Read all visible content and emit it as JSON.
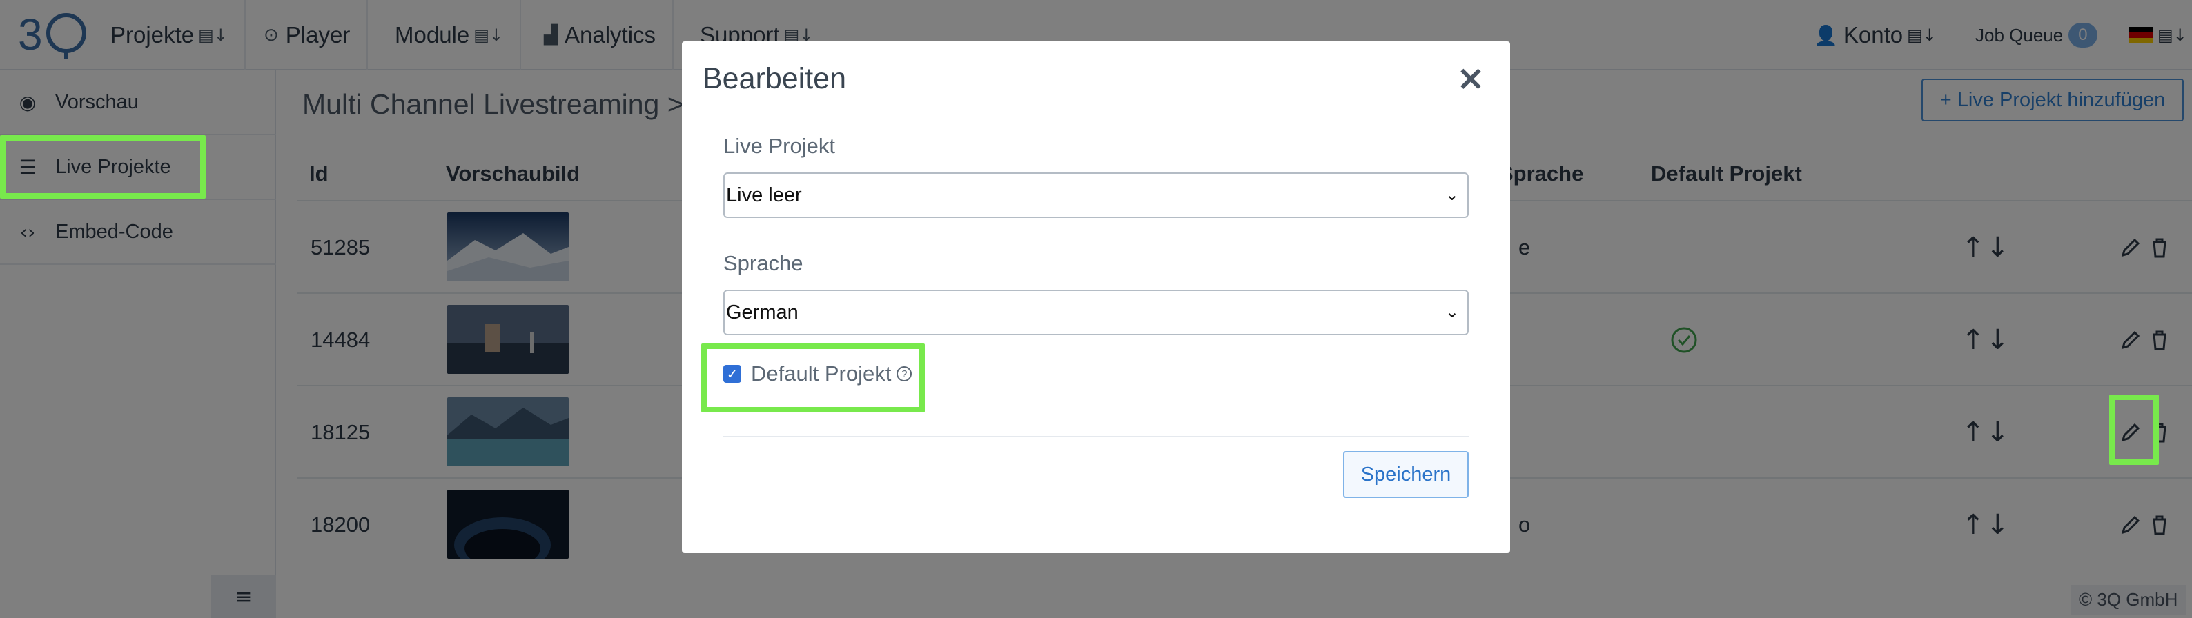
{
  "nav": {
    "projects": "Projekte",
    "player": "Player",
    "modules": "Module",
    "analytics": "Analytics",
    "support": "Support",
    "account": "Konto",
    "job_queue": "Job Queue",
    "job_queue_count": "0",
    "sort_glyph": "⇩"
  },
  "sidebar": {
    "items": [
      {
        "label": "Vorschau",
        "icon": "eye-icon"
      },
      {
        "label": "Live Projekte",
        "icon": "list-icon"
      },
      {
        "label": "Embed-Code",
        "icon": "code-icon"
      }
    ]
  },
  "main": {
    "breadcrumb": "Multi Channel Livestreaming >",
    "add_button": "+ Live Projekt hinzufügen",
    "columns": {
      "id": "Id",
      "thumbnail": "Vorschaubild",
      "language": "Sprache",
      "default": "Default Projekt"
    },
    "rows": [
      {
        "id": "51285",
        "lang_fragment": "e",
        "is_default": false
      },
      {
        "id": "14484",
        "lang_fragment": "",
        "is_default": true
      },
      {
        "id": "18125",
        "lang_fragment": "",
        "is_default": false
      },
      {
        "id": "18200",
        "lang_fragment": "o",
        "is_default": false
      }
    ],
    "footer": "© 3Q GmbH"
  },
  "modal": {
    "title": "Bearbeiten",
    "close": "×",
    "live_project_label": "Live Projekt",
    "live_project_value": "Live leer",
    "language_label": "Sprache",
    "language_value": "German",
    "default_checkbox_label": "Default Projekt",
    "default_checked": true,
    "save_button": "Speichern"
  },
  "colors": {
    "accent": "#2f7fd1",
    "highlight": "#78e94c",
    "success": "#3fa34d"
  }
}
